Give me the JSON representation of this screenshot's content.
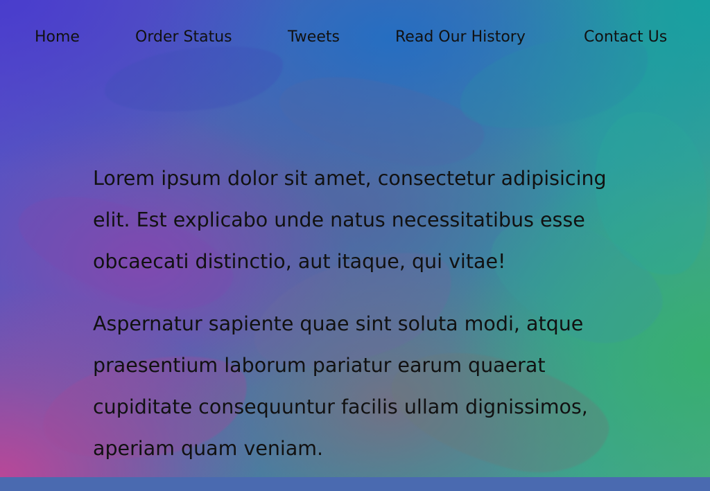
{
  "nav": {
    "items": [
      {
        "label": "Home"
      },
      {
        "label": "Order Status"
      },
      {
        "label": "Tweets"
      },
      {
        "label": "Read Our History"
      },
      {
        "label": "Contact Us"
      }
    ]
  },
  "content": {
    "paragraphs": [
      "Lorem ipsum dolor sit amet, consectetur adipisicing elit. Est explicabo unde natus necessitatibus esse obcaecati distinctio, aut itaque, qui vitae!",
      "Aspernatur sapiente quae sint soluta modi, atque praesentium laborum pariatur earum quaerat cupiditate consequuntur facilis ullam dignissimos, aperiam quam veniam."
    ]
  },
  "colors": {
    "text": "#111111",
    "bg_top_left": "#483ccd",
    "bg_top_right": "#16a0a0",
    "bg_bottom_left": "#be4696",
    "bg_bottom_right": "#37af6e"
  }
}
